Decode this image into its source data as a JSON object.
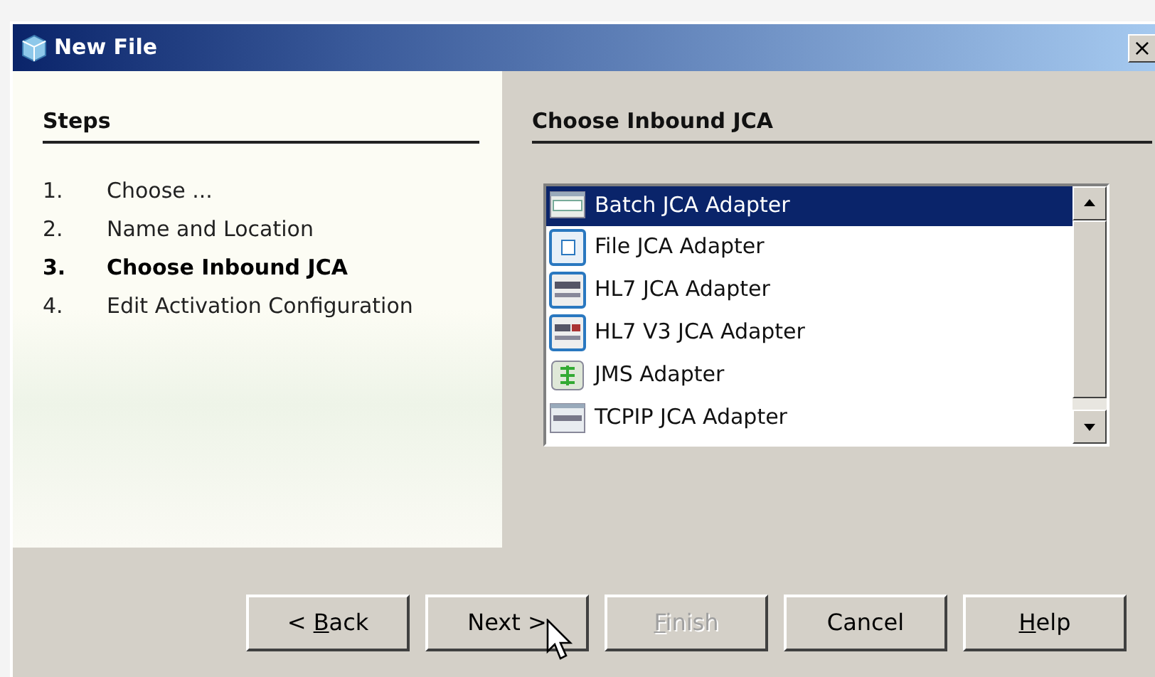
{
  "window": {
    "title": "New File",
    "close": "×"
  },
  "steps": {
    "heading": "Steps",
    "items": [
      {
        "number": "1.",
        "label": "Choose ...",
        "selected": false
      },
      {
        "number": "2.",
        "label": "Name and Location",
        "selected": false
      },
      {
        "number": "3.",
        "label": "Choose Inbound JCA",
        "selected": true
      },
      {
        "number": "4.",
        "label": "Edit Activation Configuration",
        "selected": false
      }
    ]
  },
  "panel": {
    "heading": "Choose Inbound JCA",
    "adapters": [
      {
        "label": "Batch JCA Adapter",
        "kind": "batch",
        "selected": true
      },
      {
        "label": "File JCA Adapter",
        "kind": "file",
        "selected": false
      },
      {
        "label": "HL7 JCA Adapter",
        "kind": "hl7",
        "selected": false
      },
      {
        "label": "HL7 V3 JCA Adapter",
        "kind": "hl7v3",
        "selected": false
      },
      {
        "label": "JMS Adapter",
        "kind": "jms",
        "selected": false
      },
      {
        "label": "TCPIP JCA Adapter",
        "kind": "tcpip",
        "selected": false
      }
    ]
  },
  "buttons": [
    {
      "prefix": "< ",
      "key": "B",
      "rest": "ack",
      "disabled": false
    },
    {
      "prefix": "Next >",
      "disabled": false
    },
    {
      "key": "F",
      "rest": "inish",
      "disabled": true
    },
    {
      "prefix": "Cancel",
      "disabled": false
    },
    {
      "key": "H",
      "rest": "elp",
      "disabled": false
    }
  ]
}
